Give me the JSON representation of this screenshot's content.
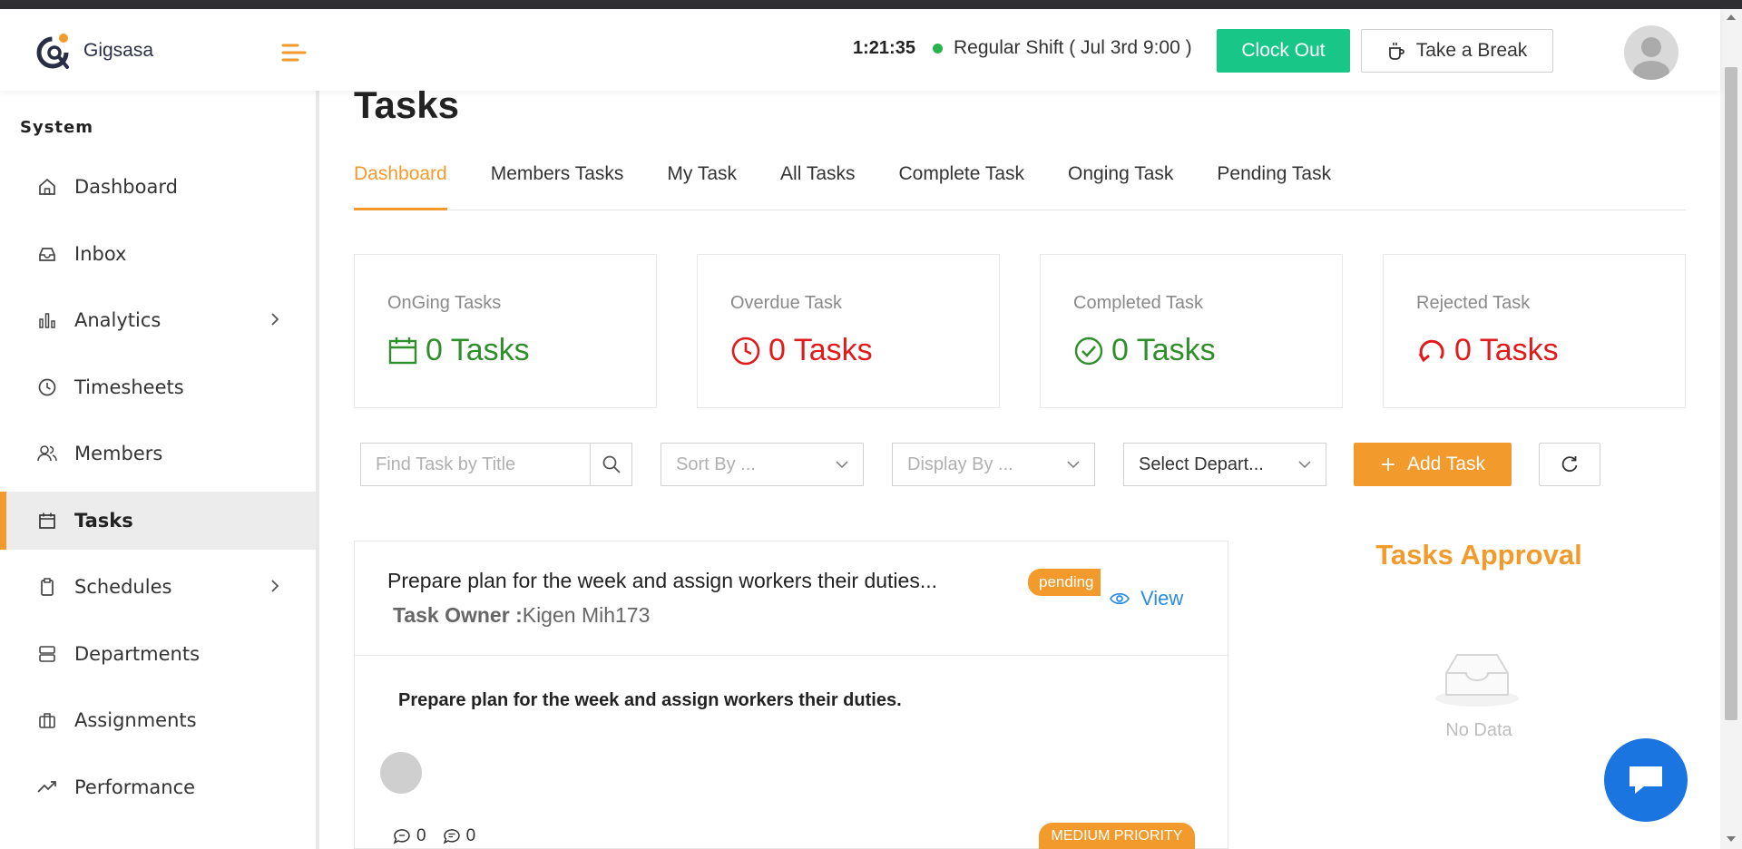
{
  "app": {
    "name": "Gigsasa"
  },
  "header": {
    "clock": "1:21:35",
    "shift": "Regular Shift ( Jul 3rd 9:00 )",
    "clock_out_label": "Clock Out",
    "break_label": "Take a Break"
  },
  "sidebar": {
    "section": "System",
    "items": [
      {
        "label": "Dashboard",
        "icon": "home-icon"
      },
      {
        "label": "Inbox",
        "icon": "inbox-icon"
      },
      {
        "label": "Analytics",
        "icon": "bar-chart-icon"
      },
      {
        "label": "Timesheets",
        "icon": "clock-icon"
      },
      {
        "label": "Members",
        "icon": "users-icon"
      },
      {
        "label": "Tasks",
        "icon": "calendar-icon"
      },
      {
        "label": "Schedules",
        "icon": "clipboard-icon"
      },
      {
        "label": "Departments",
        "icon": "server-icon"
      },
      {
        "label": "Assignments",
        "icon": "briefcase-icon"
      },
      {
        "label": "Performance",
        "icon": "trend-icon"
      }
    ]
  },
  "page": {
    "title": "Tasks",
    "tabs": [
      "Dashboard",
      "Members Tasks",
      "My Task",
      "All Tasks",
      "Complete Task",
      "Onging Task",
      "Pending Task"
    ],
    "active_tab": "Dashboard"
  },
  "stats": [
    {
      "label": "OnGing Tasks",
      "value": "0 Tasks",
      "color": "#2f8f2a",
      "icon": "calendar-icon"
    },
    {
      "label": "Overdue Task",
      "value": "0 Tasks",
      "color": "#e11b1b",
      "icon": "clock-icon"
    },
    {
      "label": "Completed Task",
      "value": "0 Tasks",
      "color": "#2f8f2a",
      "icon": "check-circle-icon"
    },
    {
      "label": "Rejected Task",
      "value": "0 Tasks",
      "color": "#e11b1b",
      "icon": "reload-icon"
    }
  ],
  "filters": {
    "search_placeholder": "Find Task by Title",
    "sort_placeholder": "Sort By ...",
    "display_placeholder": "Display By ...",
    "department_value": "Select Depart...",
    "add_task_label": "Add Task"
  },
  "task": {
    "title": "Prepare plan for the week and assign workers their duties...",
    "status": "pending",
    "owner_label": "Task Owner :",
    "owner": "Kigen Mih173",
    "view_label": "View",
    "description": "Prepare plan for the week and assign workers their duties.",
    "comments": "0",
    "messages": "0",
    "priority": "MEDIUM PRIORITY"
  },
  "approval": {
    "title": "Tasks Approval",
    "empty": "No Data"
  },
  "colors": {
    "accent": "#f39a2c",
    "success": "#18c787",
    "link": "#2b8be6",
    "fab": "#1a75e0"
  }
}
